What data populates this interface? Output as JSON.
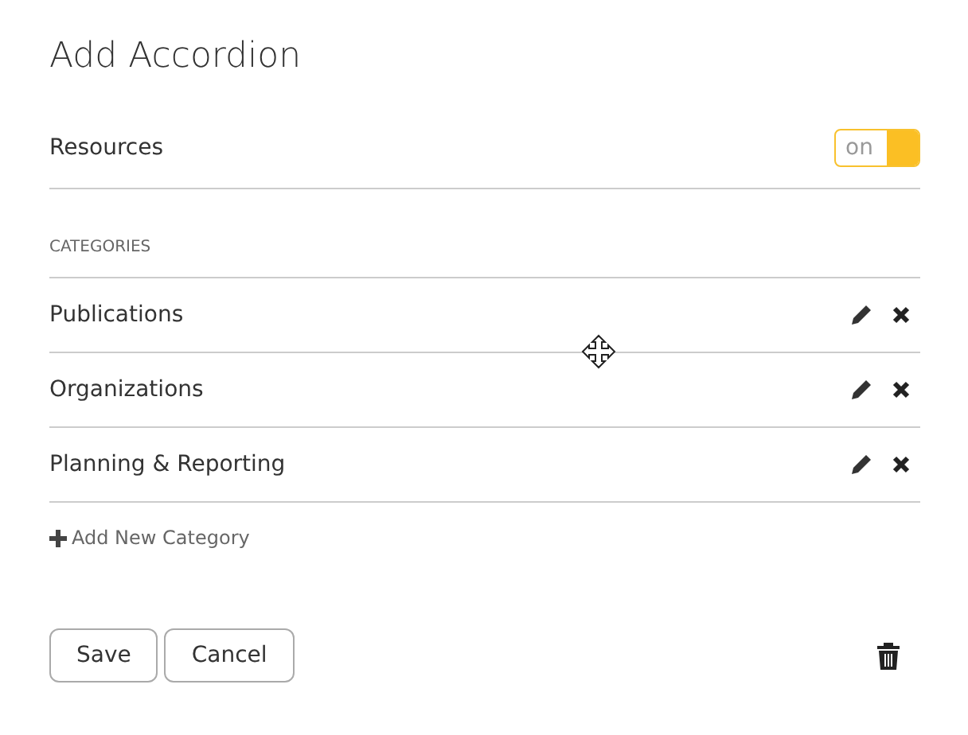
{
  "title": "Add Accordion",
  "resources": {
    "label": "Resources",
    "on": true,
    "toggle_text": "on"
  },
  "categories_heading": "CATEGORIES",
  "categories": [
    {
      "name": "Publications"
    },
    {
      "name": "Organizations"
    },
    {
      "name": "Planning & Reporting"
    }
  ],
  "add_category": "Add New Category",
  "buttons": [
    "Save",
    "Cancel"
  ]
}
